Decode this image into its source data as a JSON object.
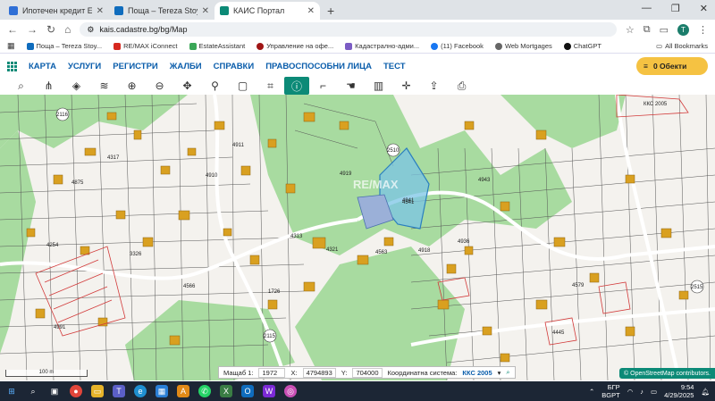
{
  "browser": {
    "tabs": [
      {
        "title": "Ипотечен кредит EX16905 по...",
        "color": "#2f6fd6",
        "active": false
      },
      {
        "title": "Поща – Tereza Stoyanova – Ou...",
        "color": "#0f6cbd",
        "active": false
      },
      {
        "title": "КАИС Портал",
        "color": "#0c8a77",
        "active": true
      }
    ],
    "url": "kais.cadastre.bg/bg/Map",
    "bookmarks": [
      {
        "label": "Поща – Tereza Stoy...",
        "color": "#0f6cbd"
      },
      {
        "label": "RE/MAX iConnect",
        "color": "#d6281f"
      },
      {
        "label": "EstateAssistant",
        "color": "#3aa757"
      },
      {
        "label": "Управление на офе...",
        "color": "#a01515"
      },
      {
        "label": "Кадастрално-адми...",
        "color": "#7b5cc4"
      },
      {
        "label": "(11) Facebook",
        "color": "#1877f2"
      },
      {
        "label": "Web Mortgages",
        "color": "#666666"
      },
      {
        "label": "ChatGPT",
        "color": "#111111"
      }
    ],
    "all_bookmarks": "All Bookmarks"
  },
  "app": {
    "menu": [
      "КАРТА",
      "УСЛУГИ",
      "РЕГИСТРИ",
      "ЖАЛБИ",
      "СПРАВКИ",
      "ПРАВОСПОСОБНИ ЛИЦА",
      "ТЕСТ"
    ],
    "objects_button": "0 Обекти",
    "tools": [
      "search-icon",
      "select-icon",
      "layers-icon",
      "stack-icon",
      "zoom-in-icon",
      "zoom-out-icon",
      "pan-icon",
      "pin-icon",
      "rectangle-icon",
      "crop-icon",
      "info-icon",
      "measure-icon",
      "hand-icon",
      "book-icon",
      "crosshair-icon",
      "export-icon",
      "print-icon"
    ],
    "active_tool": "info-icon"
  },
  "map": {
    "labels": {
      "l2116": "2116",
      "l2115": "2115",
      "l2510": "2510",
      "l2515": "2515",
      "kks": "ККС 2005",
      "p4919": "4919",
      "p4941": "4941",
      "p4541": "4541",
      "p4943": "4943",
      "p1726": "1726",
      "p4313": "4313",
      "p4321": "4321",
      "p4936": "4936",
      "p4918": "4918",
      "p4563": "4563",
      "p4579": "4579",
      "p4445": "4445",
      "p4254": "4254",
      "p4313b": "3326",
      "p4566": "4566",
      "p4991": "4991",
      "p4317": "4317",
      "p4875": "4875",
      "p4910": "4910",
      "p4911": "4911"
    },
    "watermark": "RE/MAX",
    "scale_label": "100 m"
  },
  "statusbar": {
    "scale_label": "Мащаб 1:",
    "scale_value": "1972",
    "x_label": "X:",
    "x_value": "4794893",
    "y_label": "Y:",
    "y_value": "704000",
    "system_label": "Координатна система:",
    "system_value": "ККС 2005"
  },
  "attribution": "© OpenStreetMap contributors.",
  "taskbar": {
    "lang_top": "БГР",
    "lang_bottom": "BGPT",
    "time": "9:54",
    "date": "4/29/2025"
  }
}
